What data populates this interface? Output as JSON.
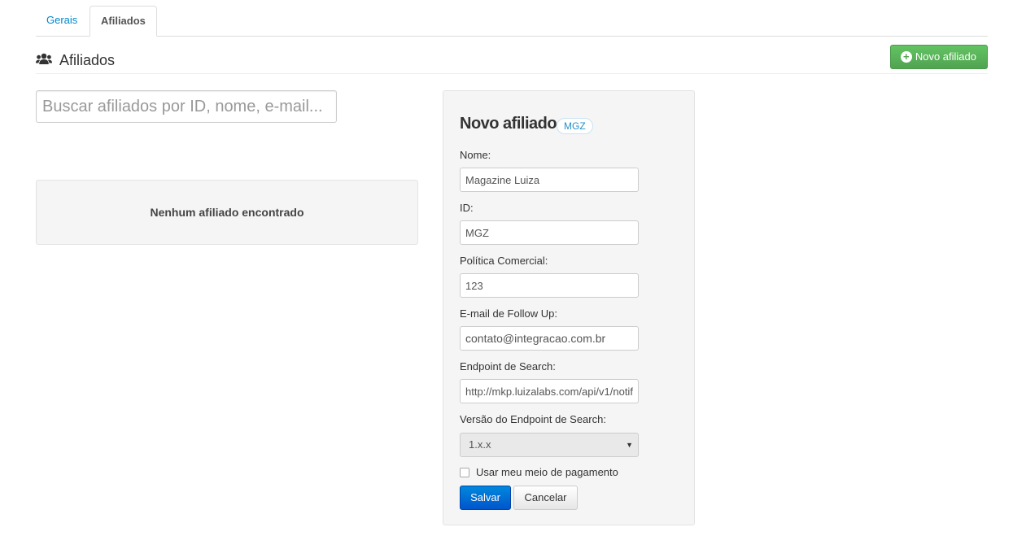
{
  "tabs": [
    {
      "label": "Gerais",
      "active": false
    },
    {
      "label": "Afiliados",
      "active": true
    }
  ],
  "header": {
    "icon": "users-icon",
    "title": "Afiliados",
    "new_button_label": "Novo afiliado",
    "new_button_icon": "plus-circle-icon"
  },
  "search": {
    "placeholder": "Buscar afiliados por ID, nome, e-mail...",
    "value": ""
  },
  "empty_state": {
    "message": "Nenhum afiliado encontrado"
  },
  "form": {
    "title": "Novo afiliado",
    "badge": "MGZ",
    "fields": {
      "nome": {
        "label": "Nome:",
        "value": "Magazine Luiza"
      },
      "id": {
        "label": "ID:",
        "value": "MGZ"
      },
      "politica": {
        "label": "Política Comercial:",
        "value": "123"
      },
      "email": {
        "label": "E-mail de Follow Up:",
        "value": "contato@integracao.com.br"
      },
      "endpoint": {
        "label": "Endpoint de Search:",
        "value": "http://mkp.luizalabs.com/api/v1/notif"
      },
      "versao": {
        "label": "Versão do Endpoint de Search:",
        "value": "1.x.x"
      }
    },
    "checkbox": {
      "label": "Usar meu meio de pagamento",
      "checked": false
    },
    "save_label": "Salvar",
    "cancel_label": "Cancelar"
  },
  "colors": {
    "link": "#0088cc",
    "success": "#51a351",
    "primary": "#0055cc",
    "badge_text": "#2a8fc7"
  }
}
